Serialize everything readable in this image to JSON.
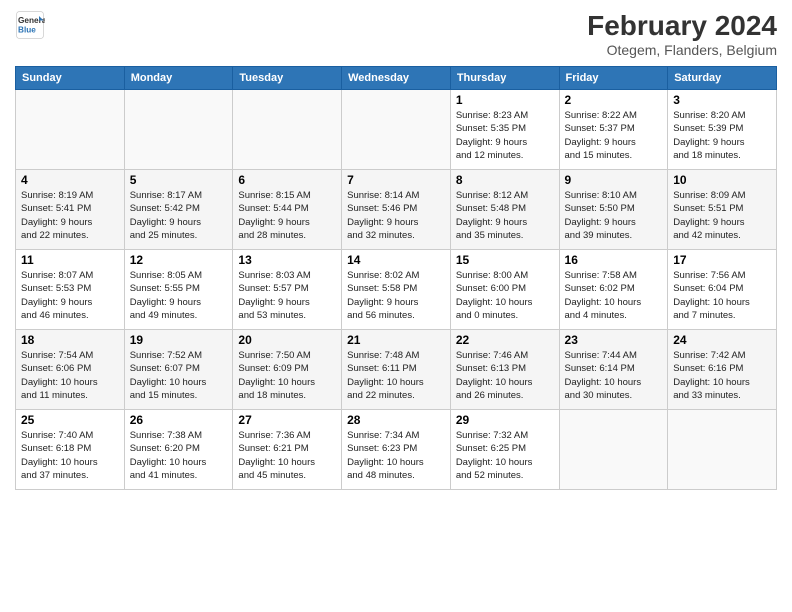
{
  "logo": {
    "line1": "General",
    "line2": "Blue"
  },
  "title": "February 2024",
  "subtitle": "Otegem, Flanders, Belgium",
  "headers": [
    "Sunday",
    "Monday",
    "Tuesday",
    "Wednesday",
    "Thursday",
    "Friday",
    "Saturday"
  ],
  "weeks": [
    {
      "days": [
        {
          "num": "",
          "text": ""
        },
        {
          "num": "",
          "text": ""
        },
        {
          "num": "",
          "text": ""
        },
        {
          "num": "",
          "text": ""
        },
        {
          "num": "1",
          "text": "Sunrise: 8:23 AM\nSunset: 5:35 PM\nDaylight: 9 hours\nand 12 minutes."
        },
        {
          "num": "2",
          "text": "Sunrise: 8:22 AM\nSunset: 5:37 PM\nDaylight: 9 hours\nand 15 minutes."
        },
        {
          "num": "3",
          "text": "Sunrise: 8:20 AM\nSunset: 5:39 PM\nDaylight: 9 hours\nand 18 minutes."
        }
      ]
    },
    {
      "days": [
        {
          "num": "4",
          "text": "Sunrise: 8:19 AM\nSunset: 5:41 PM\nDaylight: 9 hours\nand 22 minutes."
        },
        {
          "num": "5",
          "text": "Sunrise: 8:17 AM\nSunset: 5:42 PM\nDaylight: 9 hours\nand 25 minutes."
        },
        {
          "num": "6",
          "text": "Sunrise: 8:15 AM\nSunset: 5:44 PM\nDaylight: 9 hours\nand 28 minutes."
        },
        {
          "num": "7",
          "text": "Sunrise: 8:14 AM\nSunset: 5:46 PM\nDaylight: 9 hours\nand 32 minutes."
        },
        {
          "num": "8",
          "text": "Sunrise: 8:12 AM\nSunset: 5:48 PM\nDaylight: 9 hours\nand 35 minutes."
        },
        {
          "num": "9",
          "text": "Sunrise: 8:10 AM\nSunset: 5:50 PM\nDaylight: 9 hours\nand 39 minutes."
        },
        {
          "num": "10",
          "text": "Sunrise: 8:09 AM\nSunset: 5:51 PM\nDaylight: 9 hours\nand 42 minutes."
        }
      ]
    },
    {
      "days": [
        {
          "num": "11",
          "text": "Sunrise: 8:07 AM\nSunset: 5:53 PM\nDaylight: 9 hours\nand 46 minutes."
        },
        {
          "num": "12",
          "text": "Sunrise: 8:05 AM\nSunset: 5:55 PM\nDaylight: 9 hours\nand 49 minutes."
        },
        {
          "num": "13",
          "text": "Sunrise: 8:03 AM\nSunset: 5:57 PM\nDaylight: 9 hours\nand 53 minutes."
        },
        {
          "num": "14",
          "text": "Sunrise: 8:02 AM\nSunset: 5:58 PM\nDaylight: 9 hours\nand 56 minutes."
        },
        {
          "num": "15",
          "text": "Sunrise: 8:00 AM\nSunset: 6:00 PM\nDaylight: 10 hours\nand 0 minutes."
        },
        {
          "num": "16",
          "text": "Sunrise: 7:58 AM\nSunset: 6:02 PM\nDaylight: 10 hours\nand 4 minutes."
        },
        {
          "num": "17",
          "text": "Sunrise: 7:56 AM\nSunset: 6:04 PM\nDaylight: 10 hours\nand 7 minutes."
        }
      ]
    },
    {
      "days": [
        {
          "num": "18",
          "text": "Sunrise: 7:54 AM\nSunset: 6:06 PM\nDaylight: 10 hours\nand 11 minutes."
        },
        {
          "num": "19",
          "text": "Sunrise: 7:52 AM\nSunset: 6:07 PM\nDaylight: 10 hours\nand 15 minutes."
        },
        {
          "num": "20",
          "text": "Sunrise: 7:50 AM\nSunset: 6:09 PM\nDaylight: 10 hours\nand 18 minutes."
        },
        {
          "num": "21",
          "text": "Sunrise: 7:48 AM\nSunset: 6:11 PM\nDaylight: 10 hours\nand 22 minutes."
        },
        {
          "num": "22",
          "text": "Sunrise: 7:46 AM\nSunset: 6:13 PM\nDaylight: 10 hours\nand 26 minutes."
        },
        {
          "num": "23",
          "text": "Sunrise: 7:44 AM\nSunset: 6:14 PM\nDaylight: 10 hours\nand 30 minutes."
        },
        {
          "num": "24",
          "text": "Sunrise: 7:42 AM\nSunset: 6:16 PM\nDaylight: 10 hours\nand 33 minutes."
        }
      ]
    },
    {
      "days": [
        {
          "num": "25",
          "text": "Sunrise: 7:40 AM\nSunset: 6:18 PM\nDaylight: 10 hours\nand 37 minutes."
        },
        {
          "num": "26",
          "text": "Sunrise: 7:38 AM\nSunset: 6:20 PM\nDaylight: 10 hours\nand 41 minutes."
        },
        {
          "num": "27",
          "text": "Sunrise: 7:36 AM\nSunset: 6:21 PM\nDaylight: 10 hours\nand 45 minutes."
        },
        {
          "num": "28",
          "text": "Sunrise: 7:34 AM\nSunset: 6:23 PM\nDaylight: 10 hours\nand 48 minutes."
        },
        {
          "num": "29",
          "text": "Sunrise: 7:32 AM\nSunset: 6:25 PM\nDaylight: 10 hours\nand 52 minutes."
        },
        {
          "num": "",
          "text": ""
        },
        {
          "num": "",
          "text": ""
        }
      ]
    }
  ]
}
